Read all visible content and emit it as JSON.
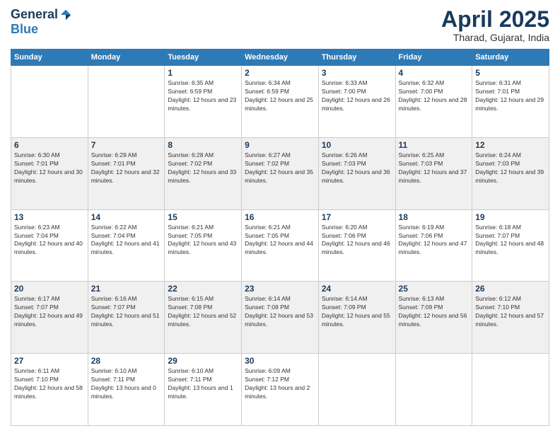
{
  "logo": {
    "general": "General",
    "blue": "Blue"
  },
  "header": {
    "month": "April 2025",
    "location": "Tharad, Gujarat, India"
  },
  "weekdays": [
    "Sunday",
    "Monday",
    "Tuesday",
    "Wednesday",
    "Thursday",
    "Friday",
    "Saturday"
  ],
  "weeks": [
    [
      {
        "day": null
      },
      {
        "day": null
      },
      {
        "day": 1,
        "sunrise": "6:35 AM",
        "sunset": "6:59 PM",
        "daylight": "12 hours and 23 minutes."
      },
      {
        "day": 2,
        "sunrise": "6:34 AM",
        "sunset": "6:59 PM",
        "daylight": "12 hours and 25 minutes."
      },
      {
        "day": 3,
        "sunrise": "6:33 AM",
        "sunset": "7:00 PM",
        "daylight": "12 hours and 26 minutes."
      },
      {
        "day": 4,
        "sunrise": "6:32 AM",
        "sunset": "7:00 PM",
        "daylight": "12 hours and 28 minutes."
      },
      {
        "day": 5,
        "sunrise": "6:31 AM",
        "sunset": "7:01 PM",
        "daylight": "12 hours and 29 minutes."
      }
    ],
    [
      {
        "day": 6,
        "sunrise": "6:30 AM",
        "sunset": "7:01 PM",
        "daylight": "12 hours and 30 minutes."
      },
      {
        "day": 7,
        "sunrise": "6:29 AM",
        "sunset": "7:01 PM",
        "daylight": "12 hours and 32 minutes."
      },
      {
        "day": 8,
        "sunrise": "6:28 AM",
        "sunset": "7:02 PM",
        "daylight": "12 hours and 33 minutes."
      },
      {
        "day": 9,
        "sunrise": "6:27 AM",
        "sunset": "7:02 PM",
        "daylight": "12 hours and 35 minutes."
      },
      {
        "day": 10,
        "sunrise": "6:26 AM",
        "sunset": "7:03 PM",
        "daylight": "12 hours and 36 minutes."
      },
      {
        "day": 11,
        "sunrise": "6:25 AM",
        "sunset": "7:03 PM",
        "daylight": "12 hours and 37 minutes."
      },
      {
        "day": 12,
        "sunrise": "6:24 AM",
        "sunset": "7:03 PM",
        "daylight": "12 hours and 39 minutes."
      }
    ],
    [
      {
        "day": 13,
        "sunrise": "6:23 AM",
        "sunset": "7:04 PM",
        "daylight": "12 hours and 40 minutes."
      },
      {
        "day": 14,
        "sunrise": "6:22 AM",
        "sunset": "7:04 PM",
        "daylight": "12 hours and 41 minutes."
      },
      {
        "day": 15,
        "sunrise": "6:21 AM",
        "sunset": "7:05 PM",
        "daylight": "12 hours and 43 minutes."
      },
      {
        "day": 16,
        "sunrise": "6:21 AM",
        "sunset": "7:05 PM",
        "daylight": "12 hours and 44 minutes."
      },
      {
        "day": 17,
        "sunrise": "6:20 AM",
        "sunset": "7:06 PM",
        "daylight": "12 hours and 46 minutes."
      },
      {
        "day": 18,
        "sunrise": "6:19 AM",
        "sunset": "7:06 PM",
        "daylight": "12 hours and 47 minutes."
      },
      {
        "day": 19,
        "sunrise": "6:18 AM",
        "sunset": "7:07 PM",
        "daylight": "12 hours and 48 minutes."
      }
    ],
    [
      {
        "day": 20,
        "sunrise": "6:17 AM",
        "sunset": "7:07 PM",
        "daylight": "12 hours and 49 minutes."
      },
      {
        "day": 21,
        "sunrise": "6:16 AM",
        "sunset": "7:07 PM",
        "daylight": "12 hours and 51 minutes."
      },
      {
        "day": 22,
        "sunrise": "6:15 AM",
        "sunset": "7:08 PM",
        "daylight": "12 hours and 52 minutes."
      },
      {
        "day": 23,
        "sunrise": "6:14 AM",
        "sunset": "7:08 PM",
        "daylight": "12 hours and 53 minutes."
      },
      {
        "day": 24,
        "sunrise": "6:14 AM",
        "sunset": "7:09 PM",
        "daylight": "12 hours and 55 minutes."
      },
      {
        "day": 25,
        "sunrise": "6:13 AM",
        "sunset": "7:09 PM",
        "daylight": "12 hours and 56 minutes."
      },
      {
        "day": 26,
        "sunrise": "6:12 AM",
        "sunset": "7:10 PM",
        "daylight": "12 hours and 57 minutes."
      }
    ],
    [
      {
        "day": 27,
        "sunrise": "6:11 AM",
        "sunset": "7:10 PM",
        "daylight": "12 hours and 58 minutes."
      },
      {
        "day": 28,
        "sunrise": "6:10 AM",
        "sunset": "7:11 PM",
        "daylight": "13 hours and 0 minutes."
      },
      {
        "day": 29,
        "sunrise": "6:10 AM",
        "sunset": "7:11 PM",
        "daylight": "13 hours and 1 minute."
      },
      {
        "day": 30,
        "sunrise": "6:09 AM",
        "sunset": "7:12 PM",
        "daylight": "13 hours and 2 minutes."
      },
      {
        "day": null
      },
      {
        "day": null
      },
      {
        "day": null
      }
    ]
  ]
}
